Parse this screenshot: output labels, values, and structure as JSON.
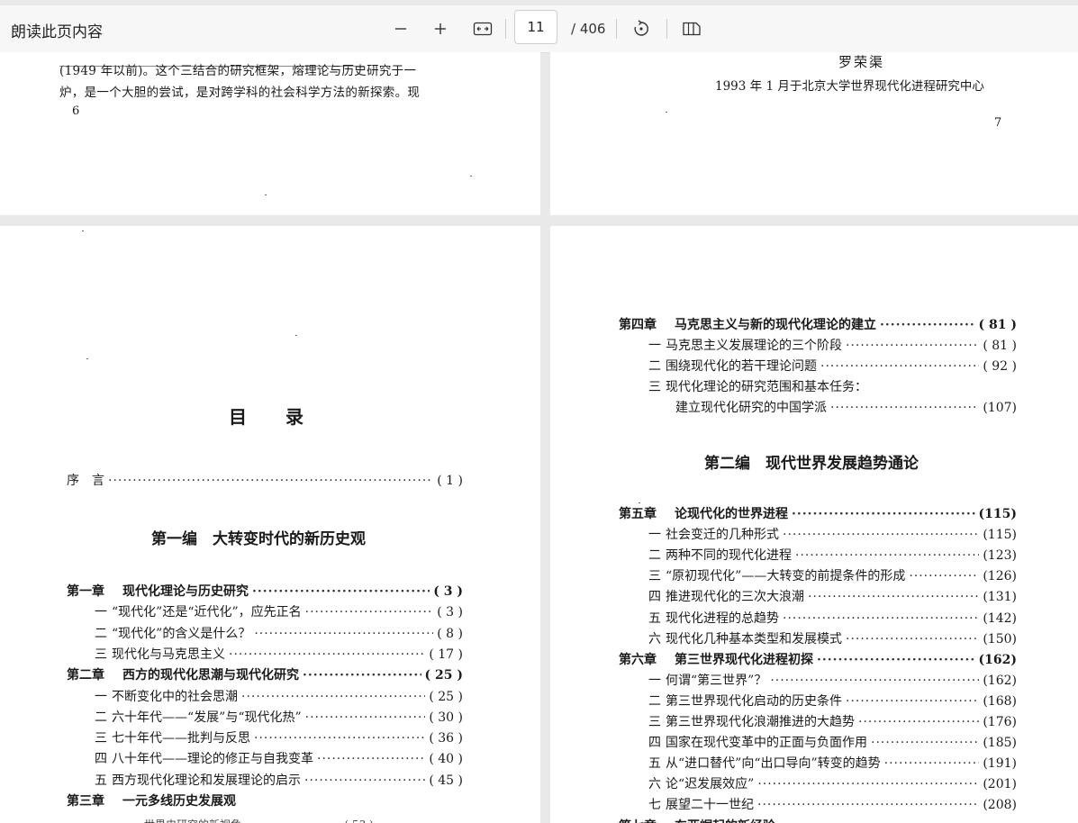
{
  "toolbar": {
    "read_aloud": "朗读此页内容",
    "page_input": "11",
    "page_total": "/ 406"
  },
  "page_top_left": {
    "line1": "(1949 年以前)。这个三结合的研究框架，熔理论与历史研究于一",
    "line2": "炉，是一个大胆的尝试，是对跨学科的社会科学方法的新探索。现",
    "page_number": "6"
  },
  "page_top_right": {
    "author": "罗荣渠",
    "dateline": "1993 年 1 月于北京大学世界现代化进程研究中心",
    "page_number": "7"
  },
  "toc_left": {
    "heading": "目　　录",
    "preface": {
      "num": "序　言",
      "title": "",
      "page": "( 1 )"
    },
    "part1_title": "第一编　大转变时代的新历史观",
    "rows": [
      {
        "num": "第一章",
        "title": "现代化理论与历史研究",
        "page": "( 3 )",
        "chapter": true
      },
      {
        "num": "一",
        "title": "“现代化”还是“近代化”，应先正名",
        "page": "( 3 )",
        "chapter": false
      },
      {
        "num": "二",
        "title": "“现代化”的含义是什么？",
        "page": "( 8 )",
        "chapter": false
      },
      {
        "num": "三",
        "title": "现代化与马克思主义",
        "page": "( 17 )",
        "chapter": false
      },
      {
        "num": "第二章",
        "title": "西方的现代化思潮与现代化研究",
        "page": "( 25 )",
        "chapter": true
      },
      {
        "num": "一",
        "title": "不断变化中的社会思潮",
        "page": "( 25 )",
        "chapter": false
      },
      {
        "num": "二",
        "title": "六十年代——“发展”与“现代化热”",
        "page": "( 30 )",
        "chapter": false
      },
      {
        "num": "三",
        "title": "七十年代——批判与反思",
        "page": "( 36 )",
        "chapter": false
      },
      {
        "num": "四",
        "title": "八十年代——理论的修正与自我变革",
        "page": "( 40 )",
        "chapter": false
      },
      {
        "num": "五",
        "title": "西方现代化理论和发展理论的启示",
        "page": "( 45 )",
        "chapter": false
      },
      {
        "num": "第三章",
        "title": "一元多线历史发展观",
        "page": "",
        "chapter": true
      }
    ]
  },
  "toc_right": {
    "rows_a": [
      {
        "num": "第四章",
        "title": "马克思主义与新的现代化理论的建立",
        "page": "( 81 )",
        "chapter": true
      },
      {
        "num": "一",
        "title": "马克思主义发展理论的三个阶段",
        "page": "( 81 )",
        "chapter": false
      },
      {
        "num": "二",
        "title": "围绕现代化的若干理论问题",
        "page": "( 92 )",
        "chapter": false
      },
      {
        "num": "三",
        "title": "现代化理论的研究范围和基本任务：",
        "page": "",
        "chapter": false
      },
      {
        "num": "",
        "title": "建立现代化研究的中国学派",
        "page": "(107)",
        "chapter": false
      }
    ],
    "part2_title": "第二编　现代世界发展趋势通论",
    "rows_b": [
      {
        "num": "第五章",
        "title": "论现代化的世界进程",
        "page": "(115)",
        "chapter": true
      },
      {
        "num": "一",
        "title": "社会变迁的几种形式",
        "page": "(115)",
        "chapter": false
      },
      {
        "num": "二",
        "title": "两种不同的现代化进程",
        "page": "(123)",
        "chapter": false
      },
      {
        "num": "三",
        "title": "“原初现代化”——大转变的前提条件的形成",
        "page": "(126)",
        "chapter": false
      },
      {
        "num": "四",
        "title": "推进现代化的三次大浪潮",
        "page": "(131)",
        "chapter": false
      },
      {
        "num": "五",
        "title": "现代化进程的总趋势",
        "page": "(142)",
        "chapter": false
      },
      {
        "num": "六",
        "title": "现代化几种基本类型和发展模式",
        "page": "(150)",
        "chapter": false
      },
      {
        "num": "第六章",
        "title": "第三世界现代化进程初探",
        "page": "(162)",
        "chapter": true
      },
      {
        "num": "一",
        "title": "何谓“第三世界”？",
        "page": "(162)",
        "chapter": false
      },
      {
        "num": "二",
        "title": "第三世界现代化启动的历史条件",
        "page": "(168)",
        "chapter": false
      },
      {
        "num": "三",
        "title": "第三世界现代化浪潮推进的大趋势",
        "page": "(176)",
        "chapter": false
      },
      {
        "num": "四",
        "title": "国家在现代变革中的正面与负面作用",
        "page": "(185)",
        "chapter": false
      },
      {
        "num": "五",
        "title": "从“进口替代”向“出口导向”转变的趋势",
        "page": "(191)",
        "chapter": false
      },
      {
        "num": "六",
        "title": "论“迟发展效应”",
        "page": "(201)",
        "chapter": false
      },
      {
        "num": "七",
        "title": "展望二十一世纪",
        "page": "(208)",
        "chapter": false
      },
      {
        "num": "第七章",
        "title": "东亚崛起的新经验",
        "page": "",
        "chapter": true
      }
    ]
  }
}
